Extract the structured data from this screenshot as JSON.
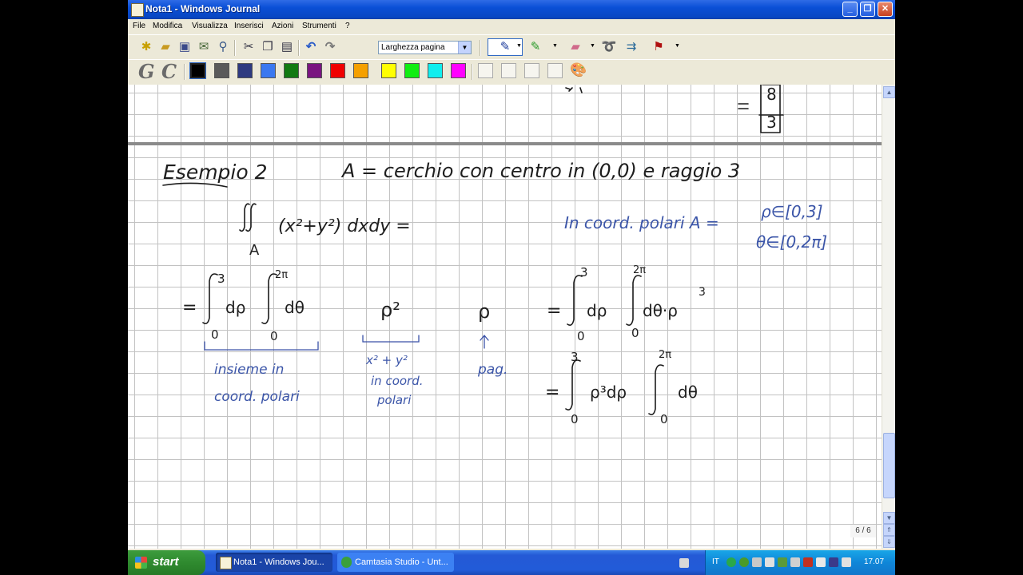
{
  "window": {
    "title": "Nota1 - Windows Journal"
  },
  "menu": [
    "File",
    "Modifica",
    "Visualizza",
    "Inserisci",
    "Azioni",
    "Strumenti",
    "?"
  ],
  "toolbar": {
    "zoom_value": "Larghezza pagina",
    "icons": [
      "new-note-icon",
      "open-icon",
      "save-icon",
      "send-icon",
      "find-icon",
      "cut-icon",
      "copy-icon",
      "paste-icon",
      "undo-icon",
      "redo-icon",
      "pen-icon",
      "highlighter-icon",
      "eraser-icon",
      "lasso-icon",
      "insert-space-icon",
      "flag-icon"
    ]
  },
  "colors": {
    "accent": "#0a4fd6",
    "ink_black": "#1c1c1c",
    "ink_blue": "#3a52a8",
    "swatches": [
      "#000000",
      "#5a5a5a",
      "#2e3a80",
      "#3a78f0",
      "#127a12",
      "#7a1480",
      "#f00000",
      "#f5a000",
      "#ffff00",
      "#11ee11",
      "#11eeee",
      "#ff00ff"
    ]
  },
  "note": {
    "top_result": {
      "numerator": "8",
      "denominator": "3"
    },
    "heading": "Esempio 2",
    "statement": "A = cerchio con centro in (0,0) e raggio 3",
    "integral": "(x²+y²) dxdy =",
    "integral_domain": "A",
    "polar_note": "In coord. polari  A =",
    "rho_range": "ρ∈[0,3]",
    "theta_range": "θ∈[0,2π]",
    "step1": "= ∫₀³ dρ ∫₀²ᵖ dθ",
    "rho_sq": "ρ²",
    "rho": "ρ",
    "step2": "= ∫₀³ dρ ∫₀²π dθ · ρ³",
    "step3": "= ∫₀³ ρ³ dρ ∫₀²π dθ",
    "annot1_line1": "insieme in",
    "annot1_line2": "coord. polari",
    "annot2_line1": "x² + y²",
    "annot2_line2": "in coord.",
    "annot2_line3": "polari",
    "annot3": "pag.",
    "limit_upper_1": "3",
    "limit_upper_2": "2π",
    "limit_lower": "0"
  },
  "page_indicator": "6 / 6",
  "taskbar": {
    "start": "start",
    "tasks": [
      "Nota1 - Windows Jou...",
      "Camtasia Studio - Unt..."
    ],
    "lang": "IT",
    "clock": "17.07"
  }
}
